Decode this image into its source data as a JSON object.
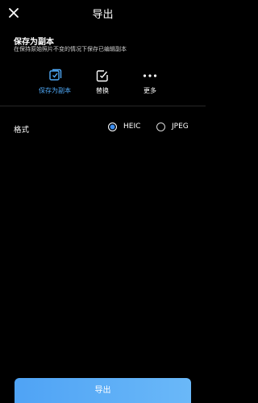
{
  "header": {
    "title": "导出",
    "close_icon": "close-icon"
  },
  "save_section": {
    "title": "保存为副本",
    "subtitle": "在保持原始照片不变的情况下保存已编辑副本"
  },
  "options": [
    {
      "label": "保存为副本",
      "icon": "save-copy-icon",
      "selected": true
    },
    {
      "label": "替换",
      "icon": "replace-icon",
      "selected": false
    },
    {
      "label": "更多",
      "icon": "more-icon",
      "selected": false
    }
  ],
  "format": {
    "label": "格式",
    "options": [
      {
        "label": "HEIC",
        "selected": true
      },
      {
        "label": "JPEG",
        "selected": false
      }
    ]
  },
  "export_button": {
    "label": "导出"
  },
  "colors": {
    "background": "#000000",
    "accent": "#4fa8f6",
    "button_gradient_start": "#4fa3f5",
    "button_gradient_end": "#6ab8f8"
  }
}
